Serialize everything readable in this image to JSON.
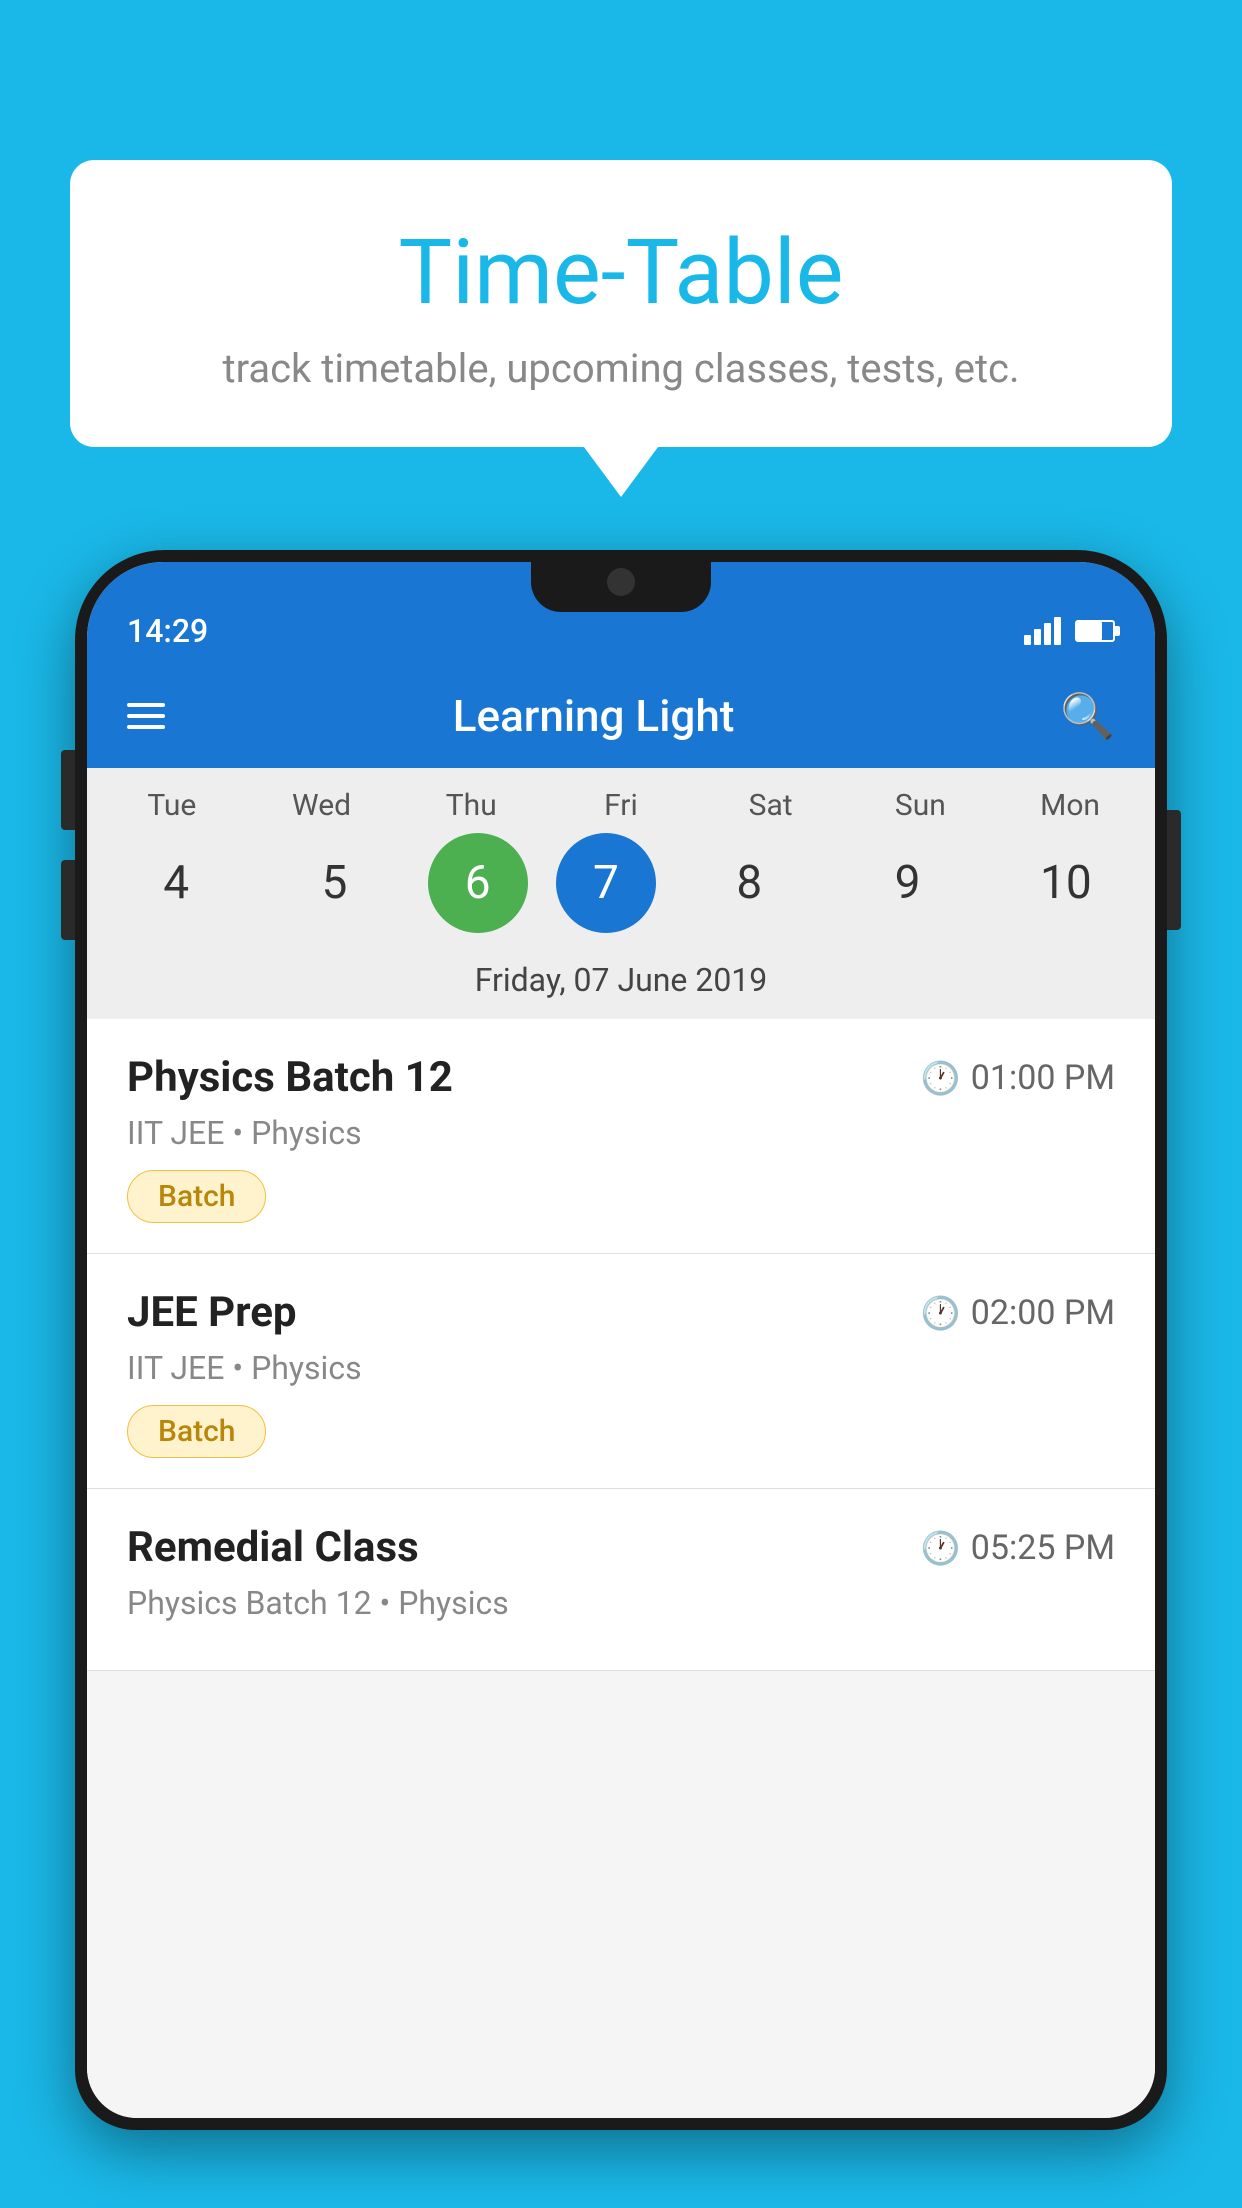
{
  "background_color": "#1ab8e8",
  "speech_bubble": {
    "title": "Time-Table",
    "subtitle": "track timetable, upcoming classes, tests, etc."
  },
  "status_bar": {
    "time": "14:29"
  },
  "app_bar": {
    "title": "Learning Light",
    "hamburger_label": "menu",
    "search_label": "search"
  },
  "calendar": {
    "days": [
      {
        "label": "Tue",
        "number": "4"
      },
      {
        "label": "Wed",
        "number": "5"
      },
      {
        "label": "Thu",
        "number": "6",
        "state": "today"
      },
      {
        "label": "Fri",
        "number": "7",
        "state": "selected"
      },
      {
        "label": "Sat",
        "number": "8"
      },
      {
        "label": "Sun",
        "number": "9"
      },
      {
        "label": "Mon",
        "number": "10"
      }
    ],
    "selected_date_label": "Friday, 07 June 2019"
  },
  "schedule_items": [
    {
      "title": "Physics Batch 12",
      "time": "01:00 PM",
      "subtitle": "IIT JEE • Physics",
      "tag": "Batch"
    },
    {
      "title": "JEE Prep",
      "time": "02:00 PM",
      "subtitle": "IIT JEE • Physics",
      "tag": "Batch"
    },
    {
      "title": "Remedial Class",
      "time": "05:25 PM",
      "subtitle": "Physics Batch 12 • Physics",
      "tag": null
    }
  ]
}
